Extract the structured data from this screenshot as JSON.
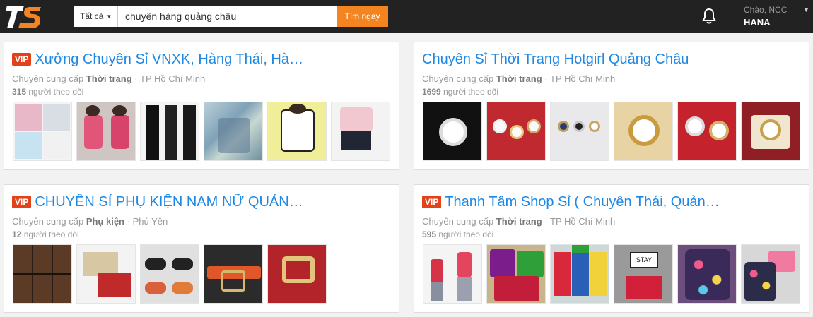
{
  "header": {
    "search_category": "Tất cả",
    "search_value": "chuyên hàng quảng châu",
    "search_button": "Tìm ngay",
    "greeting": "Chào, NCC",
    "username": "HANA",
    "logo_text": "TS"
  },
  "colors": {
    "accent": "#f38420",
    "link": "#1e88e5",
    "vip": "#e2421a",
    "topbar": "#222222"
  },
  "cards": [
    {
      "vip": "VIP",
      "title": "Xưởng Chuyên Sỉ VNXK, Hàng Thái, Hàng…",
      "supply_prefix": "Chuyên cung cấp",
      "category": "Thời trang",
      "location": "· TP Hồ Chí Minh",
      "followers": "315",
      "followers_label": "người theo dõi"
    },
    {
      "vip": "",
      "title": "Chuyên Sỉ Thời Trang Hotgirl Quảng Châu",
      "supply_prefix": "Chuyên cung cấp",
      "category": "Thời trang",
      "location": "· TP Hồ Chí Minh",
      "followers": "1699",
      "followers_label": "người theo dõi"
    },
    {
      "vip": "VIP",
      "title": "CHUYÊN SỈ PHỤ KIỆN NAM NỮ QUẢNG …",
      "supply_prefix": "Chuyên cung cấp",
      "category": "Phụ kiện",
      "location": "· Phú Yên",
      "followers": "12",
      "followers_label": "người theo dõi"
    },
    {
      "vip": "VIP",
      "title": "Thanh Tâm Shop Sỉ ( Chuyên Thái, Quảng …",
      "supply_prefix": "Chuyên cung cấp",
      "category": "Thời trang",
      "location": "· TP Hồ Chí Minh",
      "followers": "595",
      "followers_label": "người theo dõi"
    }
  ]
}
